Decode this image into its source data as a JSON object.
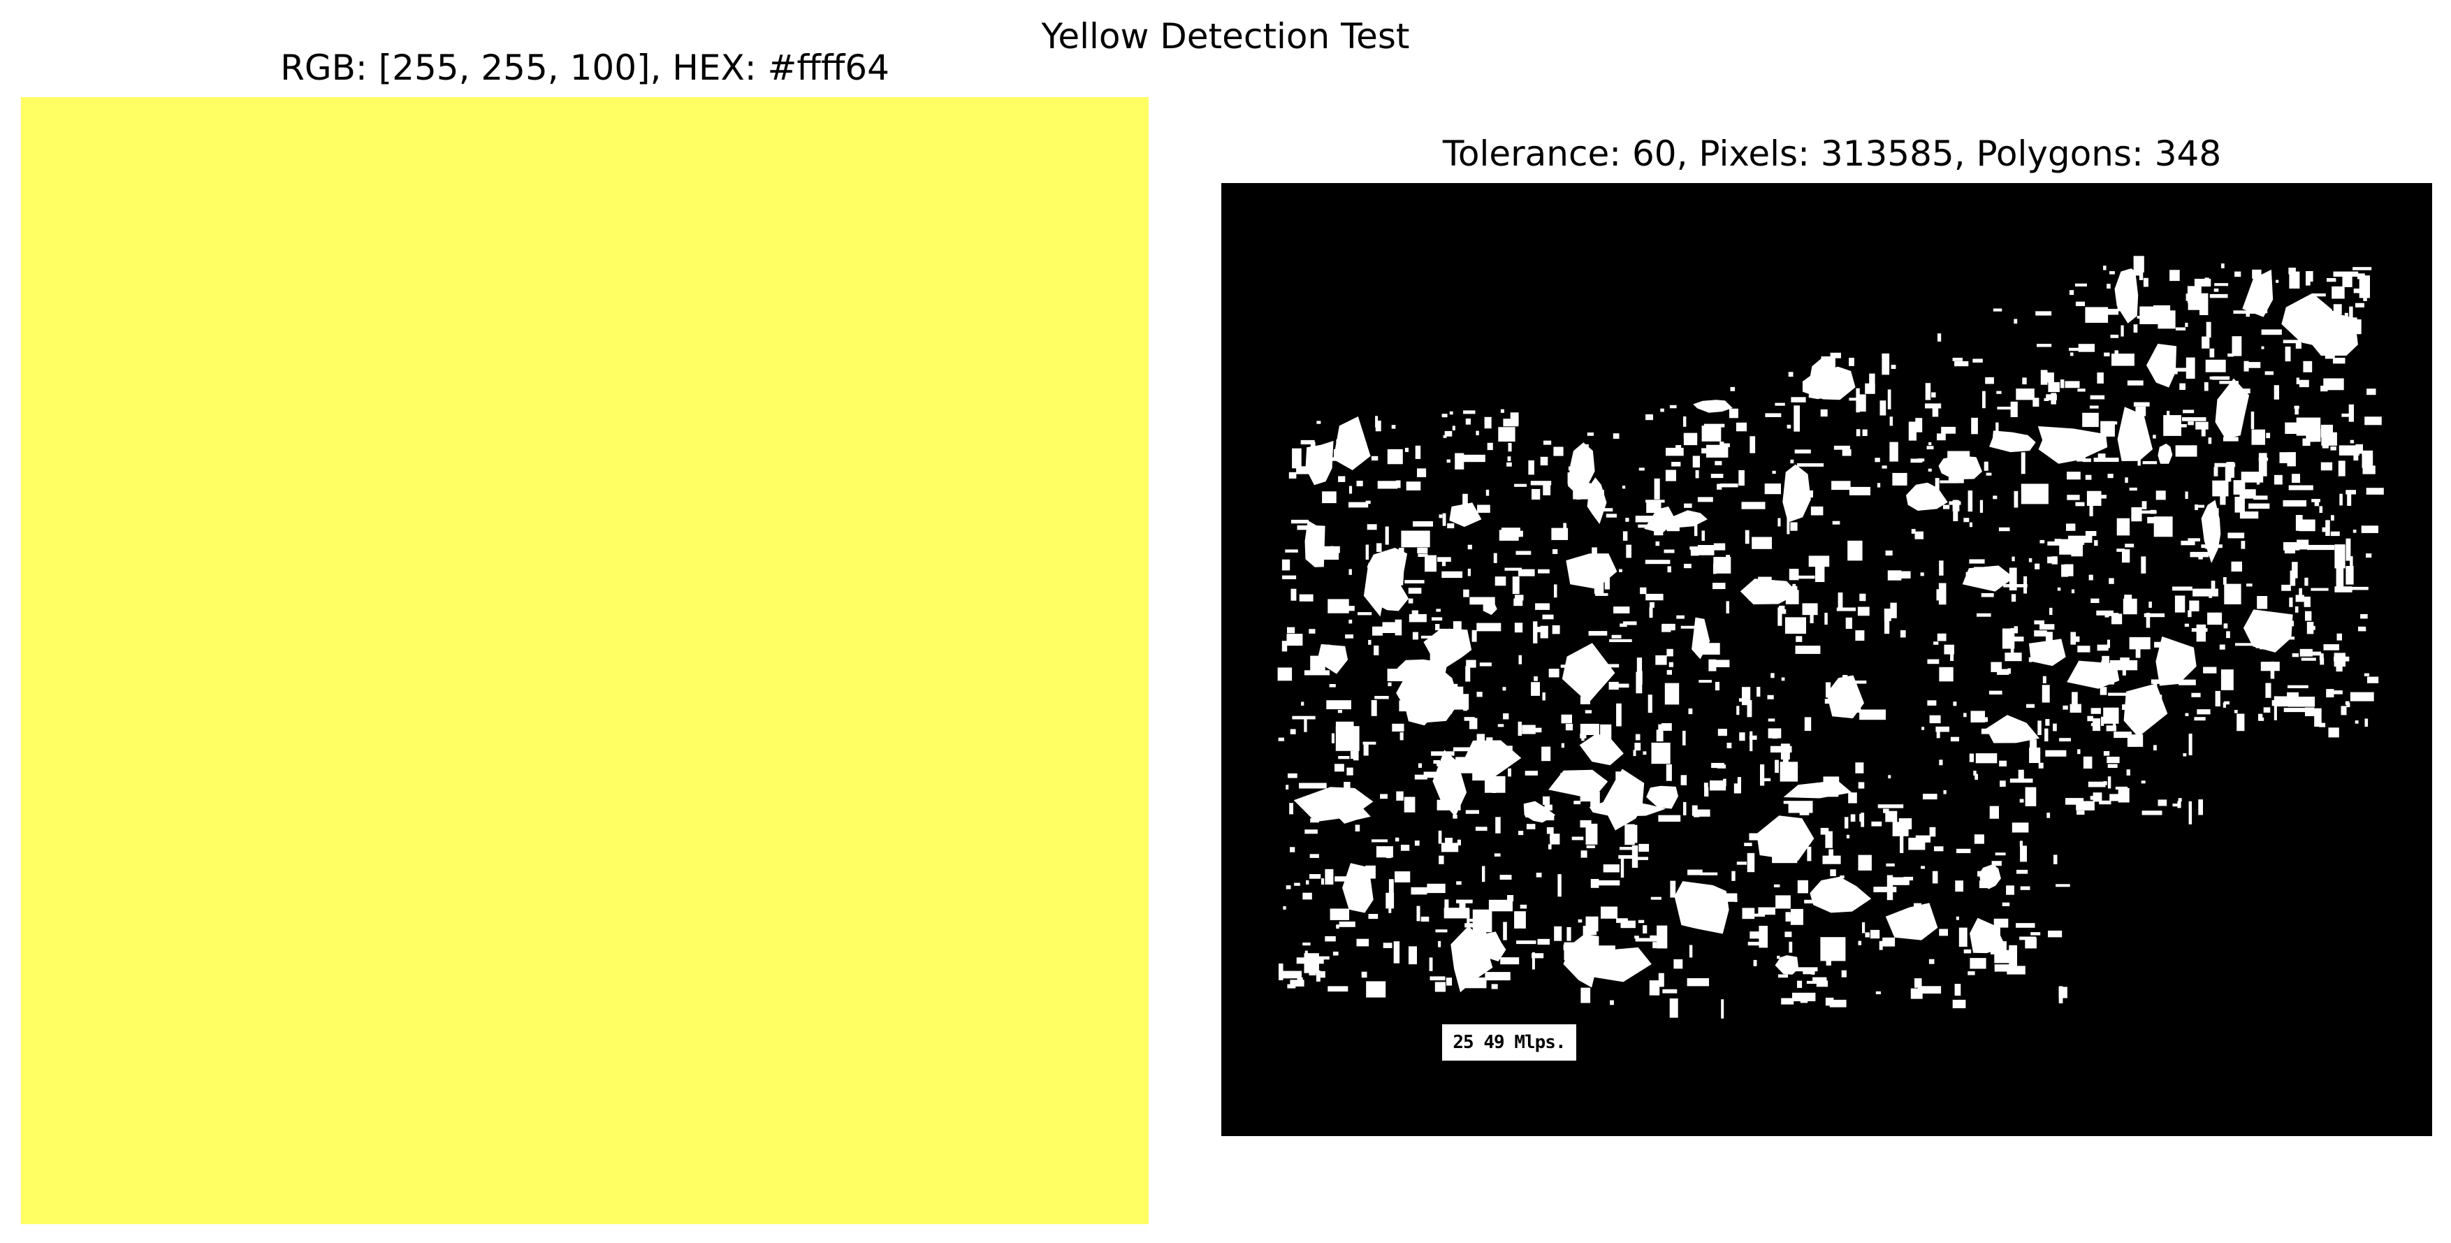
{
  "figure": {
    "suptitle": "Yellow Detection Test"
  },
  "swatch": {
    "title": "RGB: [255, 255, 100], HEX: #ffff64",
    "color": "#ffff64"
  },
  "mask": {
    "title": "Tolerance: 60, Pixels: 313585, Polygons: 348",
    "background_color": "#000000",
    "foreground_color": "#ffffff",
    "scale_label": "25 49 Mlps."
  }
}
